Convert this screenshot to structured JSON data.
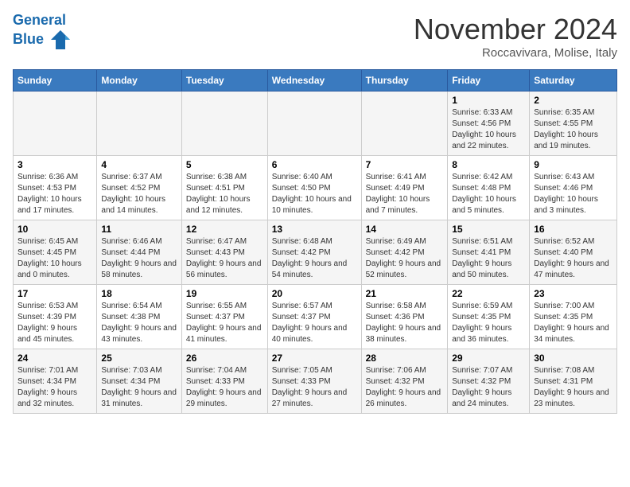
{
  "header": {
    "logo_line1": "General",
    "logo_line2": "Blue",
    "month": "November 2024",
    "location": "Roccavivara, Molise, Italy"
  },
  "weekdays": [
    "Sunday",
    "Monday",
    "Tuesday",
    "Wednesday",
    "Thursday",
    "Friday",
    "Saturday"
  ],
  "weeks": [
    [
      {
        "day": "",
        "info": ""
      },
      {
        "day": "",
        "info": ""
      },
      {
        "day": "",
        "info": ""
      },
      {
        "day": "",
        "info": ""
      },
      {
        "day": "",
        "info": ""
      },
      {
        "day": "1",
        "info": "Sunrise: 6:33 AM\nSunset: 4:56 PM\nDaylight: 10 hours and 22 minutes."
      },
      {
        "day": "2",
        "info": "Sunrise: 6:35 AM\nSunset: 4:55 PM\nDaylight: 10 hours and 19 minutes."
      }
    ],
    [
      {
        "day": "3",
        "info": "Sunrise: 6:36 AM\nSunset: 4:53 PM\nDaylight: 10 hours and 17 minutes."
      },
      {
        "day": "4",
        "info": "Sunrise: 6:37 AM\nSunset: 4:52 PM\nDaylight: 10 hours and 14 minutes."
      },
      {
        "day": "5",
        "info": "Sunrise: 6:38 AM\nSunset: 4:51 PM\nDaylight: 10 hours and 12 minutes."
      },
      {
        "day": "6",
        "info": "Sunrise: 6:40 AM\nSunset: 4:50 PM\nDaylight: 10 hours and 10 minutes."
      },
      {
        "day": "7",
        "info": "Sunrise: 6:41 AM\nSunset: 4:49 PM\nDaylight: 10 hours and 7 minutes."
      },
      {
        "day": "8",
        "info": "Sunrise: 6:42 AM\nSunset: 4:48 PM\nDaylight: 10 hours and 5 minutes."
      },
      {
        "day": "9",
        "info": "Sunrise: 6:43 AM\nSunset: 4:46 PM\nDaylight: 10 hours and 3 minutes."
      }
    ],
    [
      {
        "day": "10",
        "info": "Sunrise: 6:45 AM\nSunset: 4:45 PM\nDaylight: 10 hours and 0 minutes."
      },
      {
        "day": "11",
        "info": "Sunrise: 6:46 AM\nSunset: 4:44 PM\nDaylight: 9 hours and 58 minutes."
      },
      {
        "day": "12",
        "info": "Sunrise: 6:47 AM\nSunset: 4:43 PM\nDaylight: 9 hours and 56 minutes."
      },
      {
        "day": "13",
        "info": "Sunrise: 6:48 AM\nSunset: 4:42 PM\nDaylight: 9 hours and 54 minutes."
      },
      {
        "day": "14",
        "info": "Sunrise: 6:49 AM\nSunset: 4:42 PM\nDaylight: 9 hours and 52 minutes."
      },
      {
        "day": "15",
        "info": "Sunrise: 6:51 AM\nSunset: 4:41 PM\nDaylight: 9 hours and 50 minutes."
      },
      {
        "day": "16",
        "info": "Sunrise: 6:52 AM\nSunset: 4:40 PM\nDaylight: 9 hours and 47 minutes."
      }
    ],
    [
      {
        "day": "17",
        "info": "Sunrise: 6:53 AM\nSunset: 4:39 PM\nDaylight: 9 hours and 45 minutes."
      },
      {
        "day": "18",
        "info": "Sunrise: 6:54 AM\nSunset: 4:38 PM\nDaylight: 9 hours and 43 minutes."
      },
      {
        "day": "19",
        "info": "Sunrise: 6:55 AM\nSunset: 4:37 PM\nDaylight: 9 hours and 41 minutes."
      },
      {
        "day": "20",
        "info": "Sunrise: 6:57 AM\nSunset: 4:37 PM\nDaylight: 9 hours and 40 minutes."
      },
      {
        "day": "21",
        "info": "Sunrise: 6:58 AM\nSunset: 4:36 PM\nDaylight: 9 hours and 38 minutes."
      },
      {
        "day": "22",
        "info": "Sunrise: 6:59 AM\nSunset: 4:35 PM\nDaylight: 9 hours and 36 minutes."
      },
      {
        "day": "23",
        "info": "Sunrise: 7:00 AM\nSunset: 4:35 PM\nDaylight: 9 hours and 34 minutes."
      }
    ],
    [
      {
        "day": "24",
        "info": "Sunrise: 7:01 AM\nSunset: 4:34 PM\nDaylight: 9 hours and 32 minutes."
      },
      {
        "day": "25",
        "info": "Sunrise: 7:03 AM\nSunset: 4:34 PM\nDaylight: 9 hours and 31 minutes."
      },
      {
        "day": "26",
        "info": "Sunrise: 7:04 AM\nSunset: 4:33 PM\nDaylight: 9 hours and 29 minutes."
      },
      {
        "day": "27",
        "info": "Sunrise: 7:05 AM\nSunset: 4:33 PM\nDaylight: 9 hours and 27 minutes."
      },
      {
        "day": "28",
        "info": "Sunrise: 7:06 AM\nSunset: 4:32 PM\nDaylight: 9 hours and 26 minutes."
      },
      {
        "day": "29",
        "info": "Sunrise: 7:07 AM\nSunset: 4:32 PM\nDaylight: 9 hours and 24 minutes."
      },
      {
        "day": "30",
        "info": "Sunrise: 7:08 AM\nSunset: 4:31 PM\nDaylight: 9 hours and 23 minutes."
      }
    ]
  ]
}
